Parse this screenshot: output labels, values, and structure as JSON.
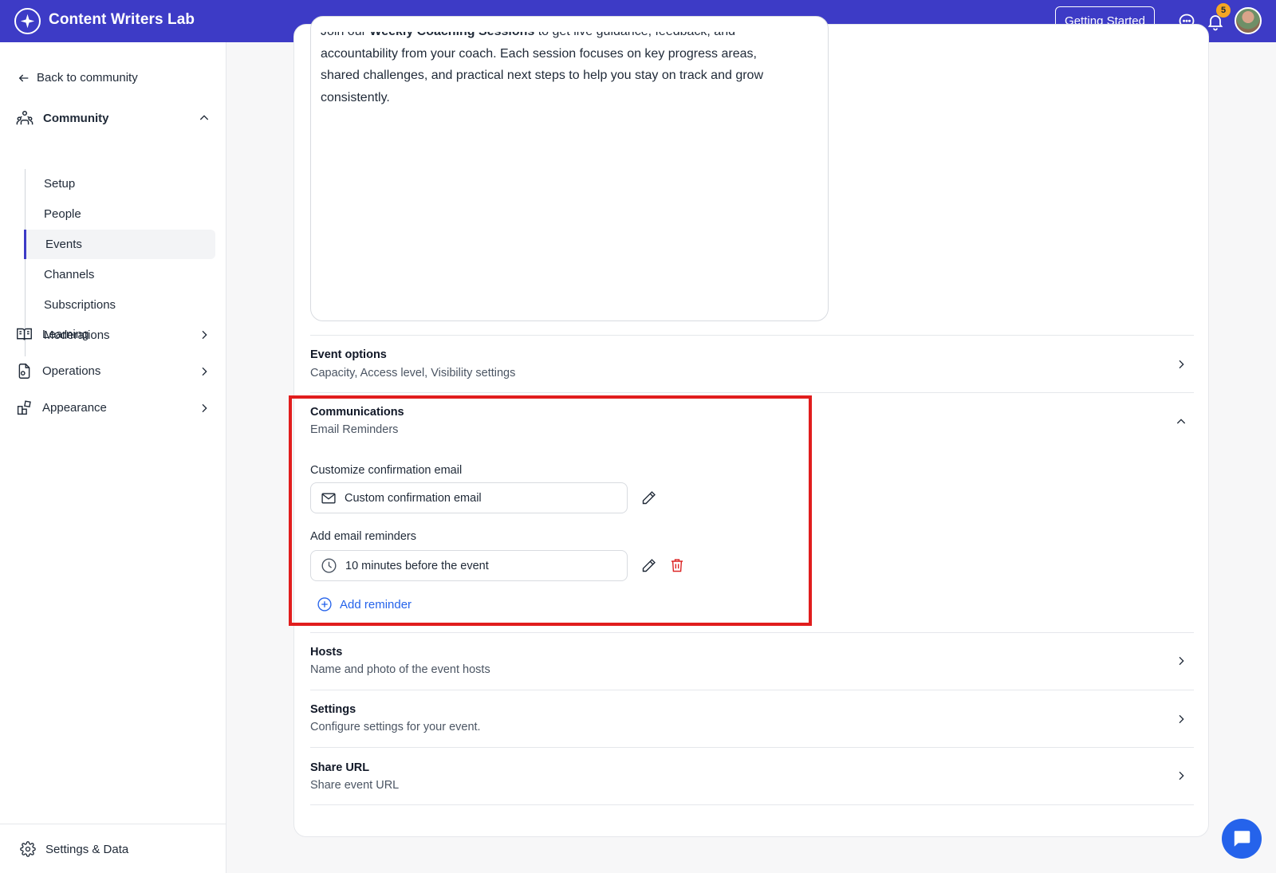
{
  "app": {
    "title": "Content Writers Lab",
    "getting_started_label": "Getting Started",
    "notification_count": "5",
    "accent_color": "#3d3bc6"
  },
  "sidebar": {
    "back_label": "Back to community",
    "community": {
      "label": "Community",
      "items": [
        {
          "label": "Setup"
        },
        {
          "label": "People"
        },
        {
          "label": "Events",
          "active": true
        },
        {
          "label": "Channels"
        },
        {
          "label": "Subscriptions"
        },
        {
          "label": "Moderations"
        }
      ]
    },
    "groups": [
      {
        "label": "Learning",
        "icon": "book-icon"
      },
      {
        "label": "Operations",
        "icon": "operations-icon"
      },
      {
        "label": "Appearance",
        "icon": "appearance-icon"
      }
    ],
    "footer_label": "Settings & Data"
  },
  "editor": {
    "line0_pre": "Join our ",
    "line0_bold": "Weekly Coaching Sessions",
    "line0_post": " to get live guidance, feedback, and",
    "line1": "accountability from your coach. Each session focuses on key progress areas,",
    "line2": "shared challenges, and practical next steps to help you stay on track and grow",
    "line3": "consistently."
  },
  "sections": {
    "event_options": {
      "title": "Event options",
      "desc": "Capacity, Access level, Visibility settings"
    },
    "communications": {
      "title": "Communications",
      "desc": "Email Reminders",
      "confirm_label": "Customize confirmation email",
      "confirm_value": "Custom confirmation email",
      "reminders_label": "Add email reminders",
      "reminder_value": "10 minutes before the event",
      "add_reminder_label": "Add reminder"
    },
    "hosts": {
      "title": "Hosts",
      "desc": "Name and photo of the event hosts"
    },
    "settings": {
      "title": "Settings",
      "desc": "Configure settings for your event."
    },
    "share_url": {
      "title": "Share URL",
      "desc": "Share event URL"
    }
  }
}
